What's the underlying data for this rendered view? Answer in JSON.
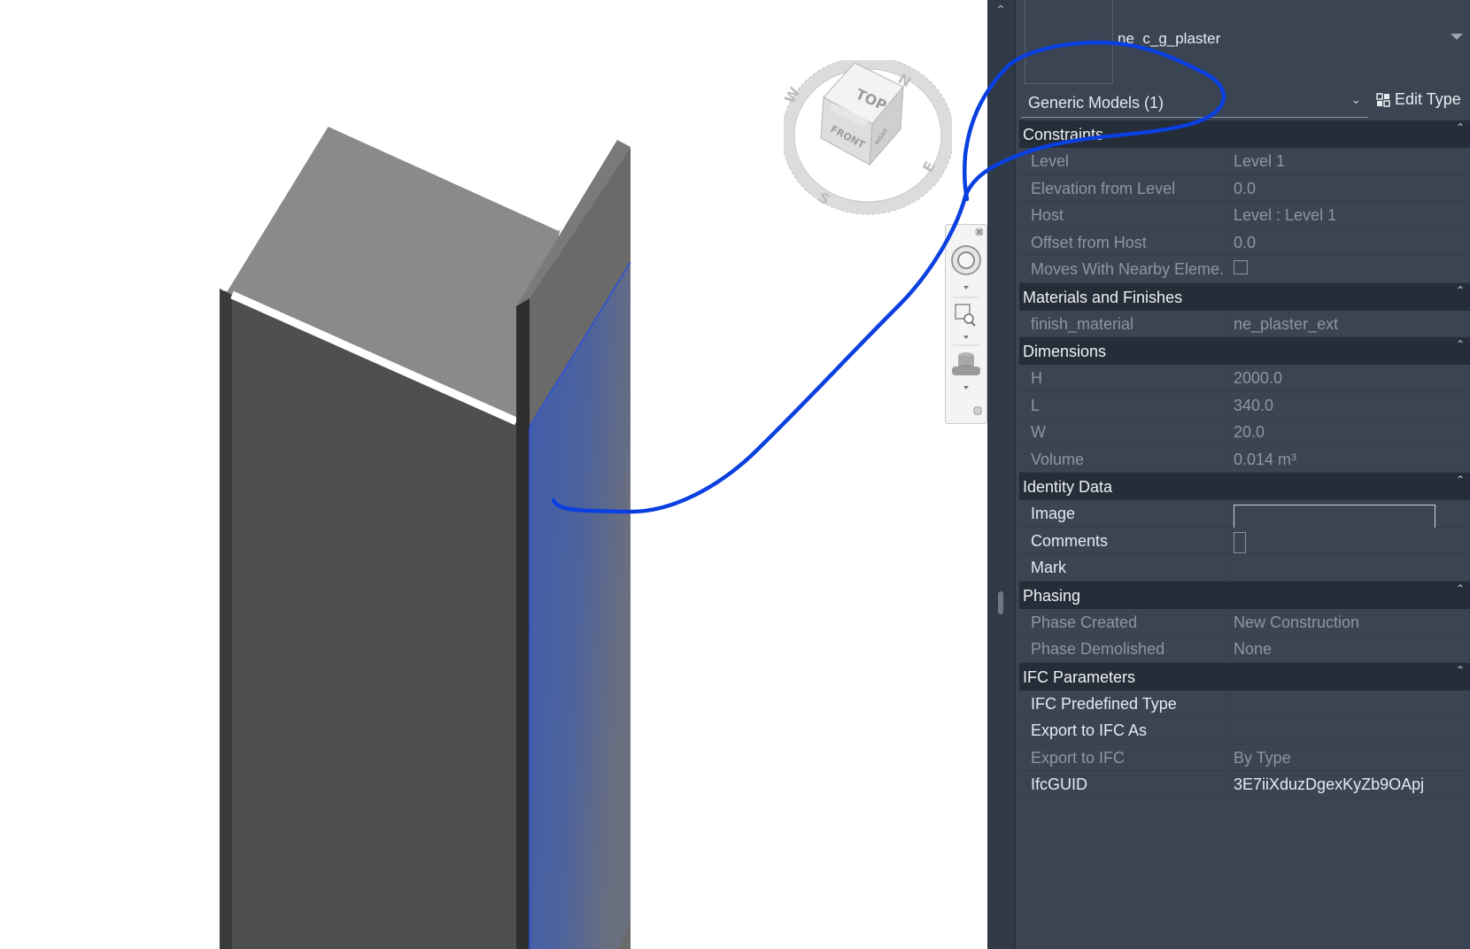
{
  "viewcube": {
    "top_label": "TOP",
    "front_label": "FRONT",
    "right_label": "RIGHT",
    "compass": {
      "n": "N",
      "e": "E",
      "s": "S",
      "w": "W"
    }
  },
  "nav_bar": {
    "icons": [
      "steering-wheel-icon",
      "zoom-region-icon",
      "orbit-icon"
    ]
  },
  "scroll": {
    "up_glyph": "⌃"
  },
  "properties": {
    "type_name": "ne_c_g_plaster",
    "category": "Generic Models (1)",
    "category_chevron": "⌄",
    "edit_type_label": "Edit Type",
    "collapse_glyph": "⌃",
    "groups": [
      {
        "title": "Constraints",
        "rows": [
          {
            "label": "Level",
            "value": "Level 1",
            "style": "dim"
          },
          {
            "label": "Elevation from Level",
            "value": "0.0",
            "style": "dim"
          },
          {
            "label": "Host",
            "value": "Level : Level 1",
            "style": "dim"
          },
          {
            "label": "Offset from Host",
            "value": "0.0",
            "style": "dim"
          },
          {
            "label": "Moves With Nearby Eleme...",
            "value": "",
            "style": "dim",
            "control": "checkbox"
          }
        ]
      },
      {
        "title": "Materials and Finishes",
        "rows": [
          {
            "label": "finish_material",
            "value": "ne_plaster_ext",
            "style": "dim"
          }
        ]
      },
      {
        "title": "Dimensions",
        "rows": [
          {
            "label": "H",
            "value": "2000.0",
            "style": "dim"
          },
          {
            "label": "L",
            "value": "340.0",
            "style": "dim"
          },
          {
            "label": "W",
            "value": "20.0",
            "style": "dim"
          },
          {
            "label": "Volume",
            "value": "0.014 m³",
            "style": "dim"
          }
        ]
      },
      {
        "title": "Identity Data",
        "rows": [
          {
            "label": "Image",
            "value": "",
            "style": "bright",
            "control": "image"
          },
          {
            "label": "Comments",
            "value": "",
            "style": "bright",
            "control": "comments"
          },
          {
            "label": "Mark",
            "value": "",
            "style": "bright"
          }
        ]
      },
      {
        "title": "Phasing",
        "rows": [
          {
            "label": "Phase Created",
            "value": "New Construction",
            "style": "dim"
          },
          {
            "label": "Phase Demolished",
            "value": "None",
            "style": "dim"
          }
        ]
      },
      {
        "title": "IFC Parameters",
        "rows": [
          {
            "label": "IFC Predefined Type",
            "value": "",
            "style": "bright"
          },
          {
            "label": "Export to IFC As",
            "value": "",
            "style": "bright"
          },
          {
            "label": "Export to IFC",
            "value": "By Type",
            "style": "dim"
          },
          {
            "label": "IfcGUID",
            "value": "3E7iiXduzDgexKyZb9OApj",
            "style": "bright"
          }
        ]
      }
    ]
  },
  "colors": {
    "panel_bg": "#3b4453",
    "group_header_bg": "#252d38",
    "selection_blue": "#3b5aa8",
    "annotation_stroke": "#0a3fe0"
  }
}
